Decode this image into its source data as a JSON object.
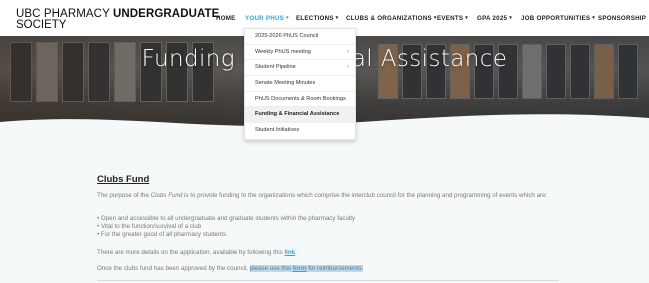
{
  "logo": {
    "line1_prefix": "UBC PHARMACY ",
    "line1_bold": "UNDERGRADUATE",
    "line2": "SOCIETY"
  },
  "nav": [
    {
      "label": "HOME",
      "caret": ""
    },
    {
      "label": "YOUR PHUS",
      "caret": "▾"
    },
    {
      "label": "ELECTIONS",
      "caret": "▾"
    },
    {
      "label": "CLUBS & ORGANIZATIONS",
      "caret": "▾"
    },
    {
      "label": "EVENTS",
      "caret": "▾"
    },
    {
      "label": "GPA 2025",
      "caret": "▾"
    },
    {
      "label": "JOB OPPORTUNITIES",
      "caret": "▾"
    },
    {
      "label": "SPONSORSHIP",
      "caret": ""
    }
  ],
  "dropdown": [
    {
      "label": "2025-2026 PhUS Council"
    },
    {
      "label": "Weekly PhUS meeting",
      "arrow": "›"
    },
    {
      "label": "Student Pipeline",
      "arrow": "›"
    },
    {
      "label": "Senate Meeting Minutes"
    },
    {
      "label": "PhUS Documents & Room Bookings"
    },
    {
      "label": "Funding & Financial Assistance"
    },
    {
      "label": "Student Initiatives"
    }
  ],
  "hero": {
    "title": "Funding & Financial Assistance"
  },
  "section": {
    "title": "Clubs Fund",
    "intro_before": "The purpose of the ",
    "intro_italic": "Clubs Fund",
    "intro_after": " is to provide funding to the organizations which comprise the interclub council for the planning and programming of events which are:",
    "bullets": [
      "• Open and accessible to all undergraduate and graduate students within the pharmacy faculty",
      "• Vital to the function/survival of a club",
      "• For the greater good of all pharmacy students"
    ],
    "details_text": "There are more details on the application, available by following this ",
    "details_link": "link",
    "details_end": ".",
    "approved_text": "Once the clubs fund has been approved by the council, ",
    "approved_hl_before": "please use this ",
    "approved_link": "form",
    "approved_hl_after": " for reimbursements."
  },
  "colors": {
    "accent": "#3aa4c8",
    "content_bg": "#f5f9fa",
    "highlight": "#b7d8ef"
  }
}
